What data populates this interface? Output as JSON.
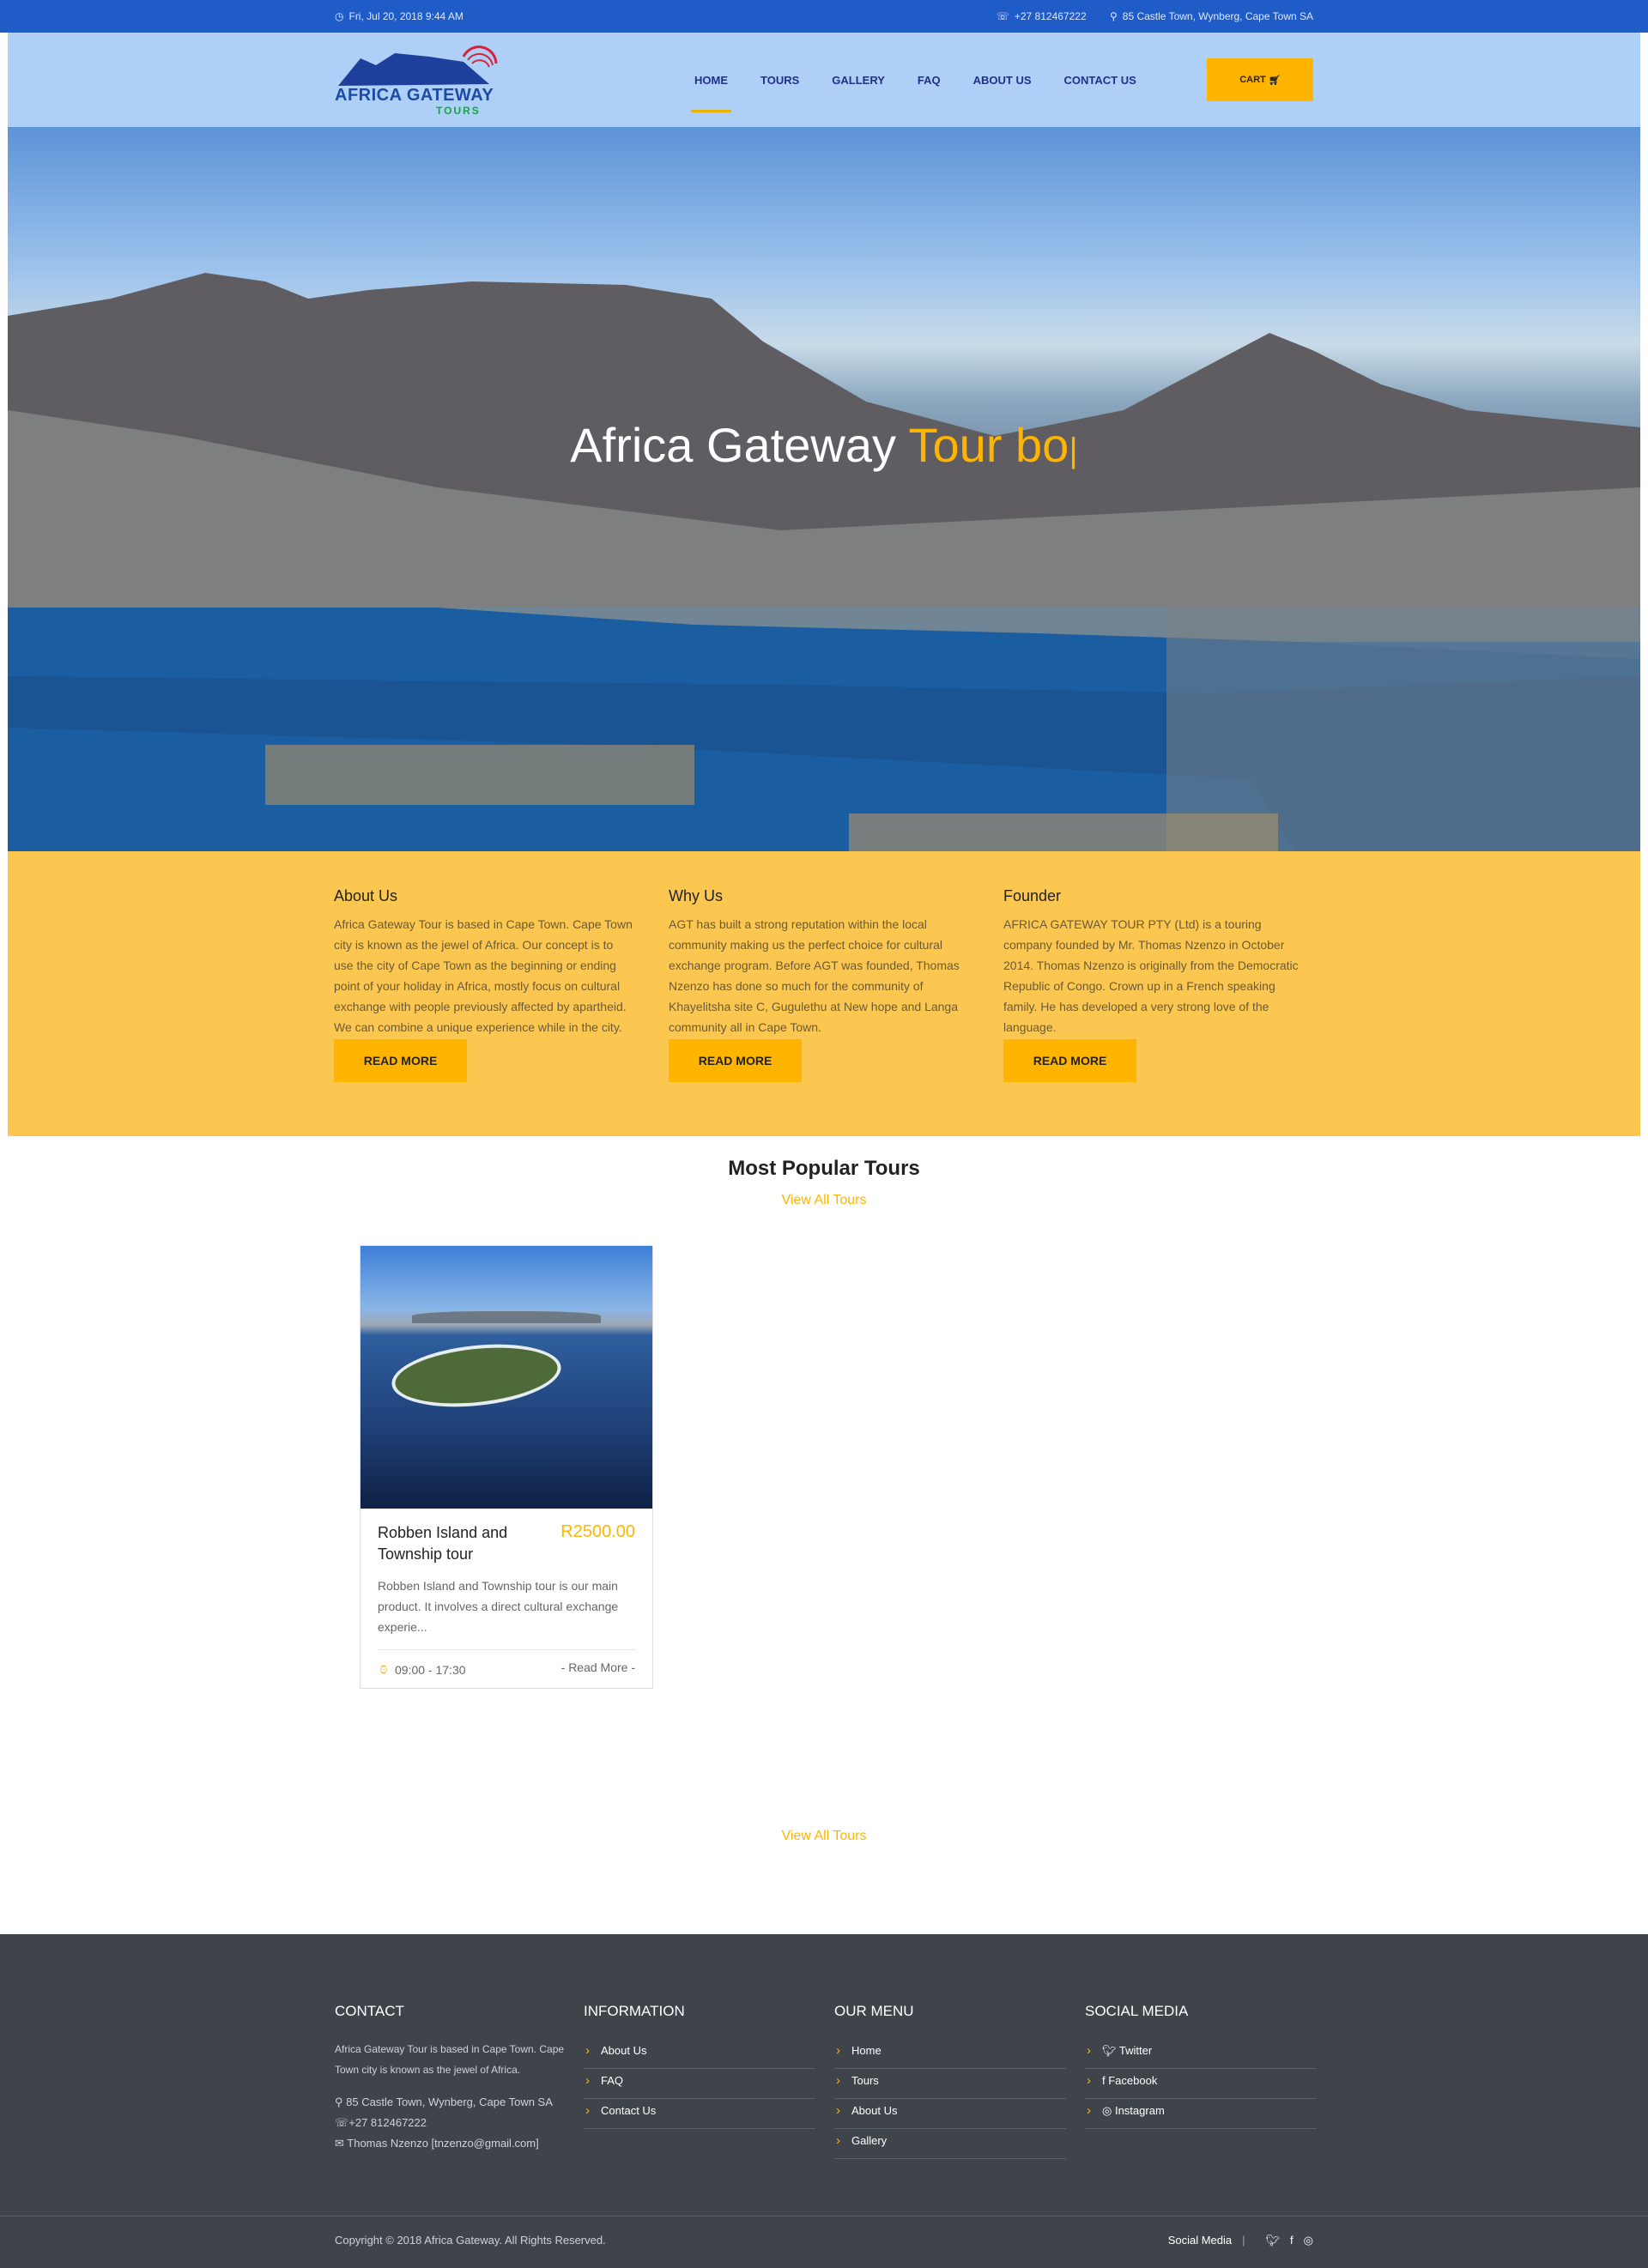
{
  "topbar": {
    "datetime": "Fri, Jul 20, 2018 9:44 AM",
    "phone": "+27 812467222",
    "address": "85 Castle Town, Wynberg, Cape Town SA"
  },
  "header": {
    "logo_line1": "AFRICA GATEWAY",
    "logo_line2": "TOURS",
    "nav": [
      "HOME",
      "TOURS",
      "GALLERY",
      "FAQ",
      "ABOUT US",
      "CONTACT US"
    ],
    "cart_label": "CART"
  },
  "hero": {
    "text_white": "Africa Gateway ",
    "text_highlight": "Tour bo"
  },
  "about": [
    {
      "title": "About Us",
      "text": "Africa Gateway Tour is based in Cape Town. Cape Town city is known as the jewel of Africa. Our concept is to use the city of Cape Town as the beginning or ending point of your holiday in Africa, mostly focus on cultural exchange with people previously affected by apartheid. We can combine a unique experience while in the city.",
      "button": "READ MORE"
    },
    {
      "title": "Why Us",
      "text": "AGT has built a strong reputation within the local community making us the perfect choice for cultural exchange program. Before AGT was founded, Thomas Nzenzo has done so much for the community of Khayelitsha site C, Gugulethu at New hope and Langa community all in Cape Town.",
      "button": "READ MORE"
    },
    {
      "title": "Founder",
      "text": "AFRICA GATEWAY TOUR PTY (Ltd) is a touring company founded by Mr. Thomas Nzenzo in October 2014. Thomas Nzenzo is originally from the Democratic Republic of Congo. Crown up in a French speaking family. He has developed a very strong love of the language.",
      "button": "READ MORE"
    }
  ],
  "popular": {
    "title": "Most Popular Tours",
    "view_all": "View All Tours",
    "view_all_bottom": "View All Tours",
    "tour": {
      "name": "Robben Island and Township tour",
      "price": "R2500.00",
      "desc": "Robben Island and Township tour is our main product. It involves a direct cultural exchange experie...",
      "time": "09:00 - 17:30",
      "read_more": "- Read More -"
    }
  },
  "footer": {
    "contact_title": "CONTACT",
    "contact_text": "Africa Gateway Tour is based in Cape Town. Cape Town city is known as the jewel of Africa.",
    "contact_address": "85 Castle Town, Wynberg, Cape Town SA",
    "contact_phone": "+27 812467222",
    "contact_email": "Thomas Nzenzo [tnzenzo@gmail.com]",
    "info_title": "INFORMATION",
    "info_links": [
      "About Us",
      "FAQ",
      "Contact Us"
    ],
    "menu_title": "OUR MENU",
    "menu_links": [
      "Home",
      "Tours",
      "About Us",
      "Gallery"
    ],
    "social_title": "SOCIAL MEDIA",
    "social_links": [
      "Twitter",
      "Facebook",
      "Instagram"
    ],
    "copyright": "Copyright © 2018 Africa Gateway. All Rights Reserved.",
    "social_label": "Social Media"
  },
  "colors": {
    "accent": "#ffb400",
    "topbar": "#1f5cc8",
    "band": "#fbc750",
    "footer": "#3f444b",
    "nav": "#22308a"
  }
}
